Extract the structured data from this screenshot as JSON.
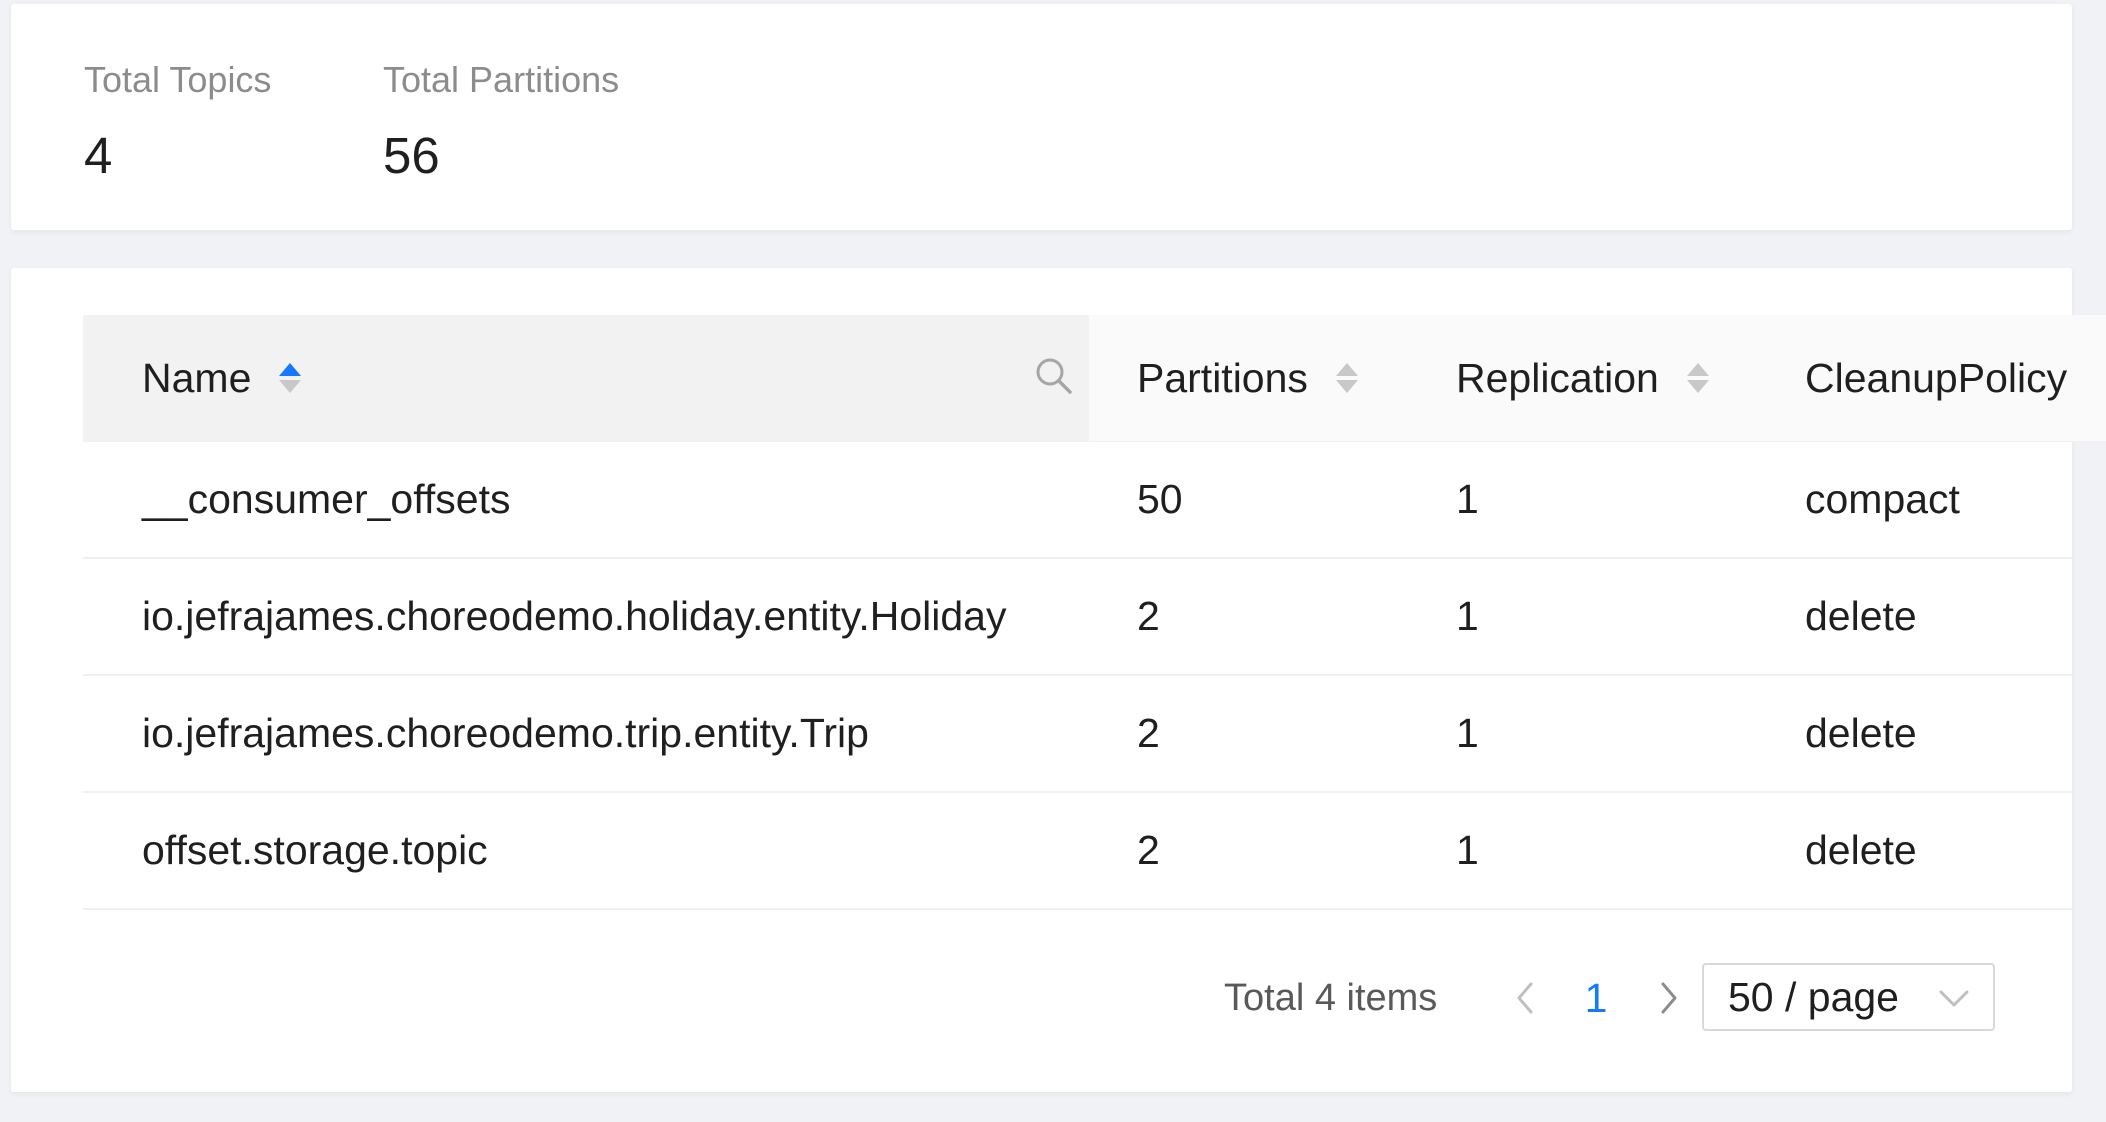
{
  "summary": {
    "total_topics_label": "Total Topics",
    "total_topics_value": "4",
    "total_partitions_label": "Total Partitions",
    "total_partitions_value": "56"
  },
  "table": {
    "columns": [
      {
        "label": "Name",
        "sortable": true,
        "sort": "ascend",
        "icon": "search-icon"
      },
      {
        "label": "Partitions",
        "sortable": true,
        "sort": "none"
      },
      {
        "label": "Replication",
        "sortable": true,
        "sort": "none"
      },
      {
        "label": "CleanupPolicy",
        "sortable": false
      }
    ],
    "rows": [
      {
        "name": "__consumer_offsets",
        "partitions": "50",
        "replication": "1",
        "cleanup_policy": "compact"
      },
      {
        "name": "io.jefrajames.choreodemo.holiday.entity.Holiday",
        "partitions": "2",
        "replication": "1",
        "cleanup_policy": "delete"
      },
      {
        "name": "io.jefrajames.choreodemo.trip.entity.Trip",
        "partitions": "2",
        "replication": "1",
        "cleanup_policy": "delete"
      },
      {
        "name": "offset.storage.topic",
        "partitions": "2",
        "replication": "1",
        "cleanup_policy": "delete"
      }
    ]
  },
  "pagination": {
    "total_text": "Total 4 items",
    "current_page": "1",
    "page_size": "50 / page",
    "prev_icon": "chevron-left-icon",
    "next_icon": "chevron-right-icon",
    "dropdown_icon": "chevron-down-icon"
  },
  "colors": {
    "accent": "#1677ff",
    "header_bg": "#fafafa",
    "page_bg": "#f0f2f5"
  }
}
